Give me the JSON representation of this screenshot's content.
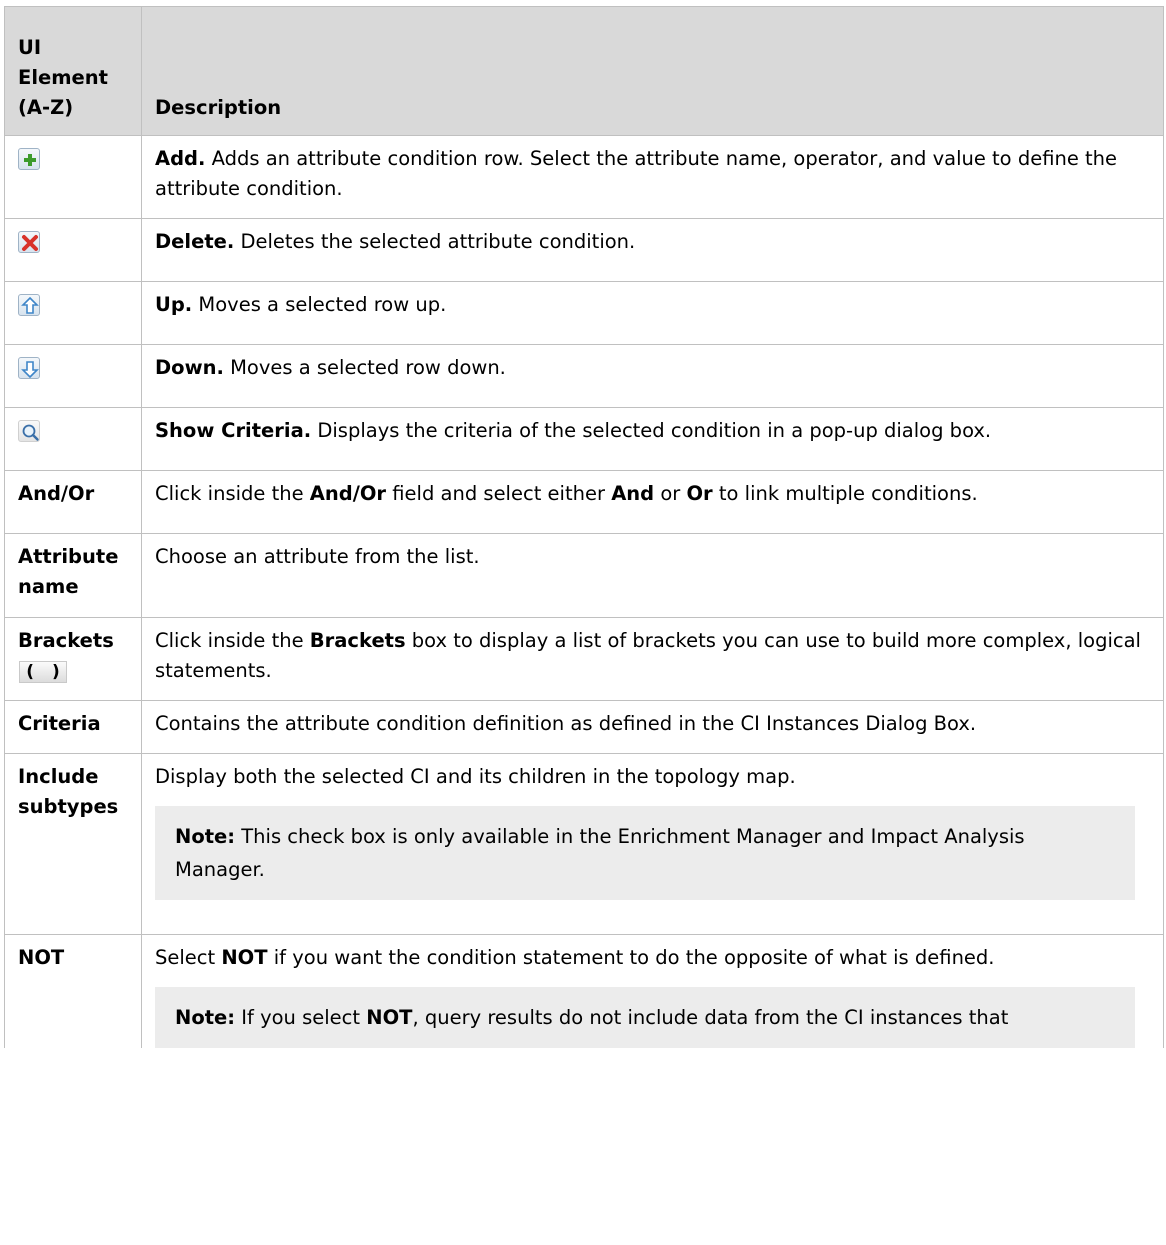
{
  "header": {
    "col1": "UI Element (A-Z)",
    "col2": "Description"
  },
  "rows": [
    {
      "icon": "add-icon",
      "term": "Add.",
      "text": " Adds an attribute condition row. Select the attribute name, operator, and value to define the attribute condition."
    },
    {
      "icon": "delete-icon",
      "term": "Delete.",
      "text": " Deletes the selected attribute condition."
    },
    {
      "icon": "up-icon",
      "term": "Up.",
      "text": " Moves a selected row up."
    },
    {
      "icon": "down-icon",
      "term": "Down.",
      "text": " Moves a selected row down."
    },
    {
      "icon": "show-criteria-icon",
      "term": "Show Criteria.",
      "text": " Displays the criteria of the selected condition in a pop-up dialog box."
    }
  ],
  "andor": {
    "element": "And/Or",
    "t1": "Click inside the ",
    "b1": "And/Or",
    "t2": " field and select either ",
    "b2": "And",
    "t3": " or ",
    "b3": "Or",
    "t4": " to link multiple conditions."
  },
  "attribute_name": {
    "element": "Attribute name",
    "text": "Choose an attribute from the list."
  },
  "brackets": {
    "element": "Brackets",
    "icon_left": "(",
    "icon_right": ")",
    "t1": "Click inside the ",
    "b1": "Brackets",
    "t2": " box to display a list of brackets you can use to build more complex, logical statements."
  },
  "criteria": {
    "element": "Criteria",
    "text": "Contains the attribute condition definition as defined in the CI Instances Dialog Box."
  },
  "include_subtypes": {
    "element": "Include subtypes",
    "text": "Display both the selected CI and its children in the topology map.",
    "note_label": "Note:",
    "note_text": " This check box is only available in the Enrichment Manager and Impact Analysis Manager."
  },
  "not": {
    "element": "NOT",
    "t1": "Select ",
    "b1": "NOT",
    "t2": " if you want the condition statement to do the opposite of what is defined.",
    "note_label": "Note:",
    "note_t1": " If you select ",
    "note_b1": "NOT",
    "note_t2": ", query results do not include data from the CI instances that"
  },
  "colors": {
    "header_bg": "#d9d9d9",
    "border": "#c0c0c0",
    "note_bg": "#ececec"
  }
}
